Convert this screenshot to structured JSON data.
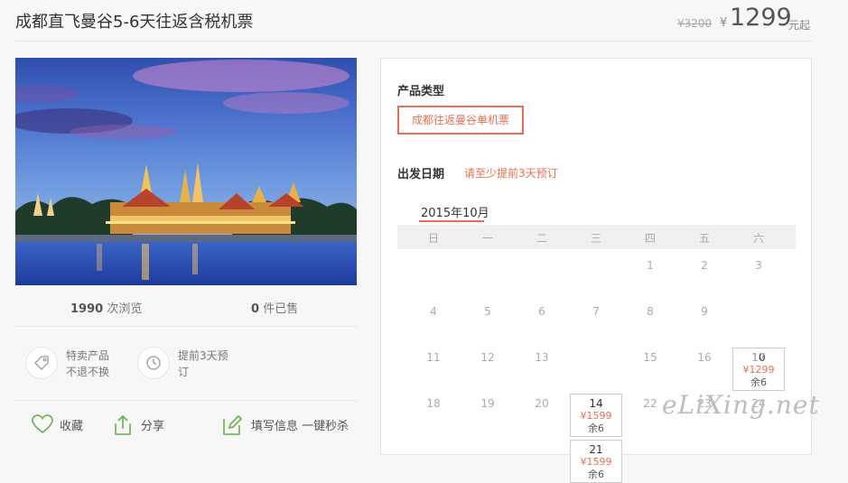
{
  "header": {
    "title": "成都直飞曼谷5-6天往返含税机票",
    "original_price": "¥3200",
    "currency_symbol": "¥",
    "price": "1299",
    "price_unit": "元起"
  },
  "stats": {
    "views_count": "1990",
    "views_label": "次浏览",
    "sold_count": "0",
    "sold_label": "件已售"
  },
  "features": [
    {
      "icon": "tag-icon",
      "line1": "特卖产品",
      "line2": "不退不换"
    },
    {
      "icon": "clock-icon",
      "line1": "提前3天预",
      "line2": "订"
    }
  ],
  "actions": {
    "favorite": "收藏",
    "share": "分享",
    "fill_info": "填写信息 一键秒杀"
  },
  "booking": {
    "product_type_label": "产品类型",
    "product_option": "成都往返曼谷单机票",
    "departure_label": "出发日期",
    "advance_note": "请至少提前3天预订",
    "month": "2015年10月",
    "weekdays": [
      "日",
      "一",
      "二",
      "三",
      "四",
      "五",
      "六"
    ],
    "rows": [
      [
        null,
        null,
        null,
        null,
        {
          "d": "1"
        },
        {
          "d": "2"
        },
        {
          "d": "3"
        }
      ],
      [
        {
          "d": "4"
        },
        {
          "d": "5"
        },
        {
          "d": "6"
        },
        {
          "d": "7"
        },
        {
          "d": "8"
        },
        {
          "d": "9"
        },
        {
          "d": "10",
          "price": "¥1299",
          "remain": "余6"
        }
      ],
      [
        {
          "d": "11"
        },
        {
          "d": "12"
        },
        {
          "d": "13"
        },
        {
          "d": "14",
          "price": "¥1599",
          "remain": "余6"
        },
        {
          "d": "15"
        },
        {
          "d": "16"
        },
        {
          "d": "17"
        }
      ],
      [
        {
          "d": "18"
        },
        {
          "d": "19"
        },
        {
          "d": "20"
        },
        {
          "d": "21",
          "price": "¥1599",
          "remain": "余6"
        },
        {
          "d": "22"
        },
        {
          "d": "23"
        },
        {
          "d": "24"
        }
      ]
    ]
  },
  "watermark": "eLiXing.net",
  "colors": {
    "accent": "#e86f55",
    "text": "#333333",
    "muted": "#aaaaaa"
  }
}
